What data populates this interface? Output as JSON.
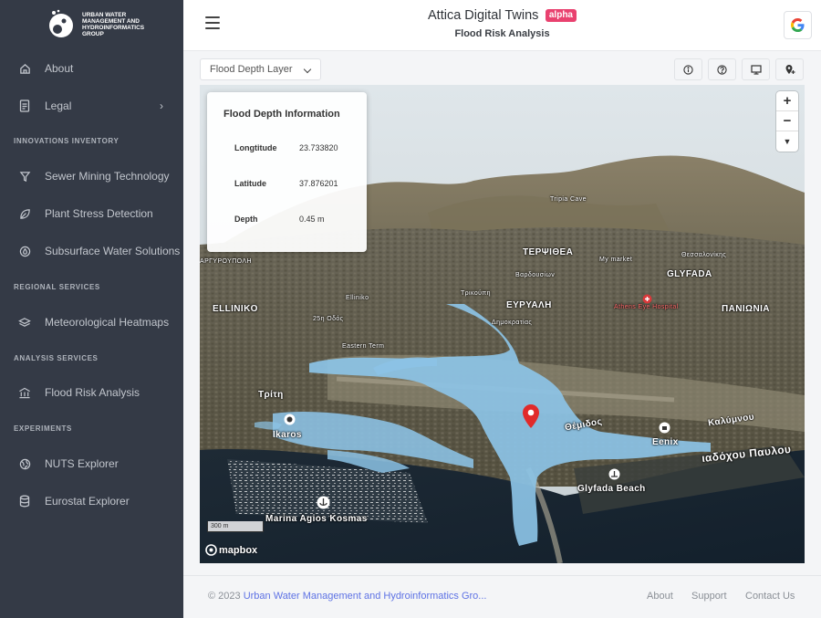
{
  "brand": {
    "logo_text": "URBAN WATER MANAGEMENT AND HYDROINFORMATICS GROUP"
  },
  "sidebar": {
    "about": "About",
    "legal": "Legal",
    "sections": {
      "innovations": "INNOVATIONS INVENTORY",
      "regional": "REGIONAL SERVICES",
      "analysis": "ANALYSIS SERVICES",
      "experiments": "EXPERIMENTS"
    },
    "items": {
      "sewer": "Sewer Mining Technology",
      "plant": "Plant Stress Detection",
      "subsurface": "Subsurface Water Solutions",
      "meteo": "Meteorological Heatmaps",
      "flood": "Flood Risk Analysis",
      "nuts": "NUTS Explorer",
      "eurostat": "Eurostat Explorer"
    }
  },
  "header": {
    "title": "Attica Digital Twins",
    "badge": "alpha",
    "subtitle": "Flood Risk Analysis"
  },
  "toolbar": {
    "layer_selected": "Flood Depth Layer"
  },
  "info_panel": {
    "title": "Flood Depth Information",
    "rows": [
      {
        "key": "Longtitude",
        "value": "23.733820"
      },
      {
        "key": "Latitude",
        "value": "37.876201"
      },
      {
        "key": "Depth",
        "value": "0.45 m"
      }
    ]
  },
  "map": {
    "labels": {
      "terpsithea": "ΤΕΡΨΙΘΕΑ",
      "glyfada": "GLYFADA",
      "ellinikо": "ELLINIKO",
      "panionia": "ΠΑΝΙΩΝΙΑ",
      "argyroupoli": "ΑΡΓΥΡΟΥΠΟΛΗ",
      "euryali": "ΕΥΡΥΑΛΗ",
      "ikaros": "Ikaros",
      "marina": "Marina Agios Kosmas",
      "glyfada_beach": "Glyfada Beach",
      "eenix": "Eenix",
      "diadoxou": "ιαδόχου Παυλου",
      "kalymnou": "Καλύμνου",
      "themidos": "Θέμιδος",
      "athens_eye": "Athens Eye Hospital",
      "tritis": "Τρίτη",
      "eastern": "Eastern Term",
      "odos25": "25η Οδός",
      "eliniko_metro": "Elliniko",
      "trikouni": "Τρικούπη",
      "dimokratias": "Δημοκρατίας",
      "vardousia": "Βαρδουσίων",
      "mymarket": "My market",
      "thessaloniki": "Θεσσαλονίκης",
      "tripia": "Tripia Cave"
    },
    "scale": "300 m",
    "attribution": "mapbox",
    "zoom_in": "+",
    "zoom_out": "−",
    "compass": "▼"
  },
  "footer": {
    "copyright_prefix": "© 2023 ",
    "copyright_link": "Urban Water Management and Hydroinformatics Gro...",
    "links": {
      "about": "About",
      "support": "Support",
      "contact": "Contact Us"
    }
  }
}
